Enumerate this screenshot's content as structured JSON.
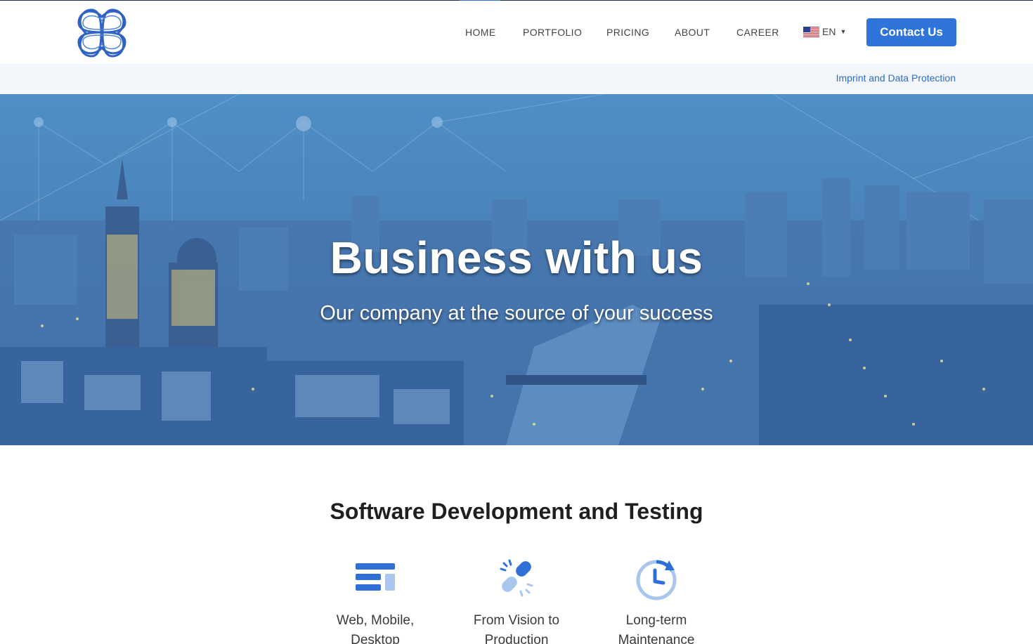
{
  "nav": {
    "items": [
      {
        "label": "HOME"
      },
      {
        "label": "PORTFOLIO"
      },
      {
        "label": "PRICING"
      },
      {
        "label": "ABOUT"
      },
      {
        "label": "CAREER"
      }
    ],
    "language": "EN",
    "contact_label": "Contact Us"
  },
  "subbar": {
    "imprint_link": "Imprint and Data Protection"
  },
  "hero": {
    "title": "Business with us",
    "subtitle": "Our company at the source of your success"
  },
  "services": {
    "title": "Software Development and Testing",
    "items": [
      {
        "label": "Web, Mobile, Desktop",
        "icon": "layout-icon"
      },
      {
        "label": "From Vision to Production",
        "icon": "broken-link-icon"
      },
      {
        "label": "Long-term Maintenance",
        "icon": "history-clock-icon"
      }
    ]
  },
  "colors": {
    "accent": "#2f74d8",
    "link": "#2f6cc2",
    "hero_overlay": "#3f72ad"
  }
}
